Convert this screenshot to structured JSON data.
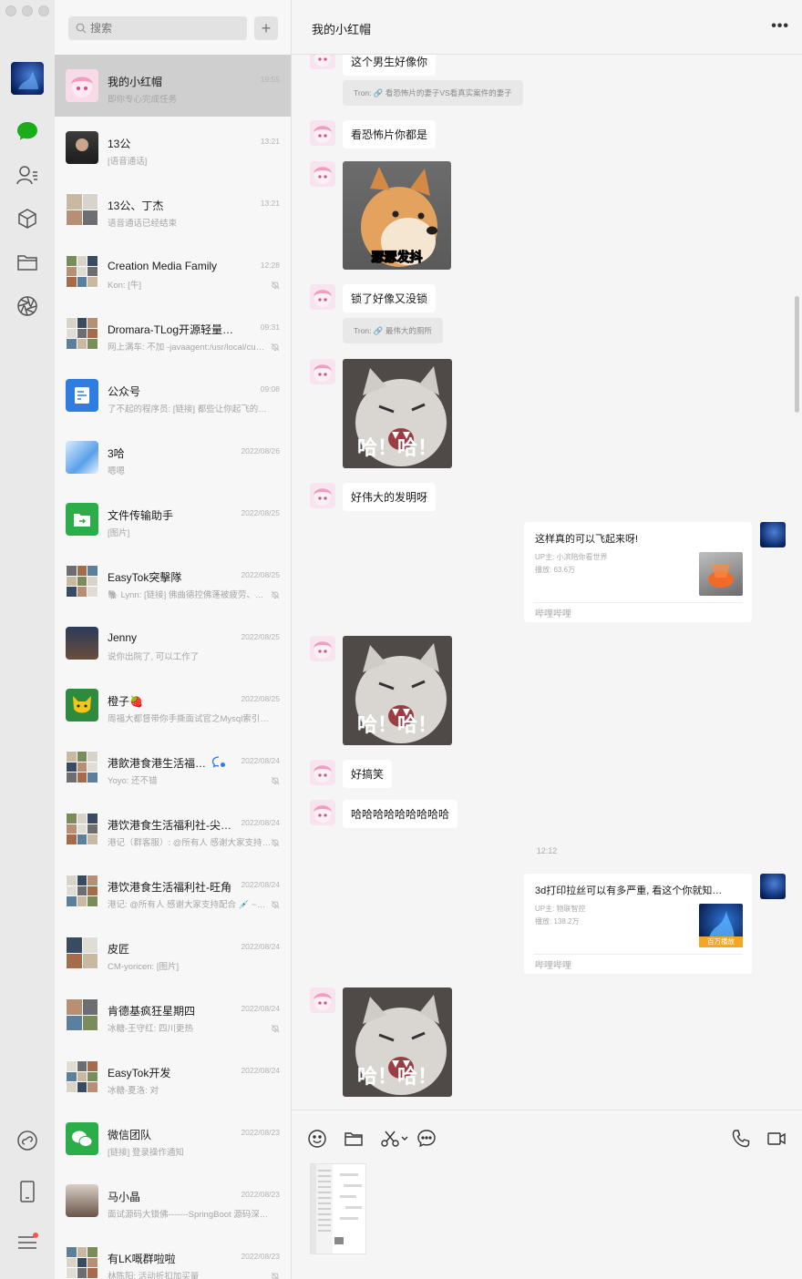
{
  "search": {
    "placeholder": "搜索",
    "add_label": "+"
  },
  "chat_list": [
    {
      "name": "我的小红帽",
      "preview": "即你专心完成任务",
      "time": "19:55",
      "avatar": "pink-anime",
      "muted": false,
      "active": true
    },
    {
      "name": "13公",
      "preview": "[语音通话]",
      "time": "13:21",
      "avatar": "man-photo",
      "muted": false
    },
    {
      "name": "13公、丁杰",
      "preview": "语音通话已经结束",
      "time": "13:21",
      "avatar": "group4",
      "muted": false
    },
    {
      "name": "Creation Media Family",
      "preview": "Kon: [牛]",
      "time": "12:28",
      "avatar": "group9",
      "muted": true
    },
    {
      "name": "Dromara-TLog开源轻量级日…",
      "preview": "网上满车: 不加 -javaagent:/usr/local/cu…",
      "time": "09:31",
      "avatar": "group9",
      "muted": true
    },
    {
      "name": "公众号",
      "preview": "了不起的程序员: [链接] 都些让你起飞的计…",
      "time": "09:08",
      "avatar": "official-account",
      "muted": false
    },
    {
      "name": "3哈",
      "preview": "嗯嗯",
      "time": "2022/08/26",
      "avatar": "anime-blue",
      "muted": false
    },
    {
      "name": "文件传输助手",
      "preview": "[图片]",
      "time": "2022/08/25",
      "avatar": "file-transfer",
      "muted": false
    },
    {
      "name": "EasyTok突擊隊",
      "preview": "🐘 Lynn: [链接] 佛曲德控佛蓬被疲劳、…",
      "time": "2022/08/25",
      "avatar": "group9",
      "muted": true
    },
    {
      "name": "Jenny",
      "preview": "说你出院了, 可以工作了",
      "time": "2022/08/25",
      "avatar": "anime-girl",
      "muted": false
    },
    {
      "name": "橙子🍓",
      "preview": "周福大都督带你手撕面试官之Mysql索引底…",
      "time": "2022/08/25",
      "avatar": "tomcat",
      "muted": false
    },
    {
      "name": "港飲港食港生活福…",
      "preview": "Yoyo: 还不错",
      "time": "2022/08/24",
      "avatar": "group9",
      "muted": true,
      "badge": true
    },
    {
      "name": "港饮港食生活福利社-尖…",
      "preview": "港记（群客服）: @所有人 感谢大家支持…",
      "time": "2022/08/24",
      "avatar": "group9",
      "muted": true
    },
    {
      "name": "港饮港食生活福利社-旺角",
      "preview": "港记: @所有人 感谢大家支持配合 💉 ~…",
      "time": "2022/08/24",
      "avatar": "group9",
      "muted": true
    },
    {
      "name": "皮匠",
      "preview": "CM-yoricen: [图片]",
      "time": "2022/08/24",
      "avatar": "group4",
      "muted": false
    },
    {
      "name": "肯德基疯狂星期四",
      "preview": "冰糖-王守红: 四川更热",
      "time": "2022/08/24",
      "avatar": "group4",
      "muted": true
    },
    {
      "name": "EasyTok开发",
      "preview": "冰糖-夏洛: 对",
      "time": "2022/08/24",
      "avatar": "group9",
      "muted": false
    },
    {
      "name": "微信团队",
      "preview": "[链接] 登录操作通知",
      "time": "2022/08/23",
      "avatar": "wechat-team",
      "muted": false
    },
    {
      "name": "马小晶",
      "preview": "面试源码大锁佛-------SpringBoot 源码深…",
      "time": "2022/08/23",
      "avatar": "anime-girl2",
      "muted": false
    },
    {
      "name": "有LK嘅群啦啦",
      "preview": "林陈阳: 活动折扣加买量",
      "time": "2022/08/23",
      "avatar": "group9",
      "muted": true
    }
  ],
  "chat": {
    "title": "我的小红帽",
    "more_label": "•••",
    "messages": {
      "m1_text": "这个男生好像你",
      "m1_quote": "Tron: 🔗 看恐怖片的妻子VS看真实案件的妻子",
      "m2_text": "看恐怖片你都是",
      "m3_sticker_caption": "瑟瑟发抖",
      "m4_text": "锁了好像又没锁",
      "m4_quote": "Tron: 🔗 最伟大的厕所",
      "cat_caption": "哈！哈！",
      "m6_text": "好伟大的发明呀",
      "card1": {
        "title": "这样真的可以飞起来呀!",
        "uploader": "UP主: 小滨陪你看世界",
        "plays": "播放: 63.6万",
        "source": "哔哩哔哩"
      },
      "m8_text": "好搞笑",
      "m9_text": "哈哈哈哈哈哈哈哈哈",
      "time_divider": "12:12",
      "card2": {
        "title": "3d打印拉丝可以有多严重, 看这个你就知…",
        "uploader": "UP主: 物联智控",
        "plays": "播放: 138.2万",
        "badge": "百万播放",
        "source": "哔哩哔哩"
      }
    }
  },
  "composer": {
    "tools": [
      "emoji-icon",
      "folder-icon",
      "scissors-icon",
      "chat-history-icon",
      "phone-icon",
      "video-icon"
    ]
  }
}
